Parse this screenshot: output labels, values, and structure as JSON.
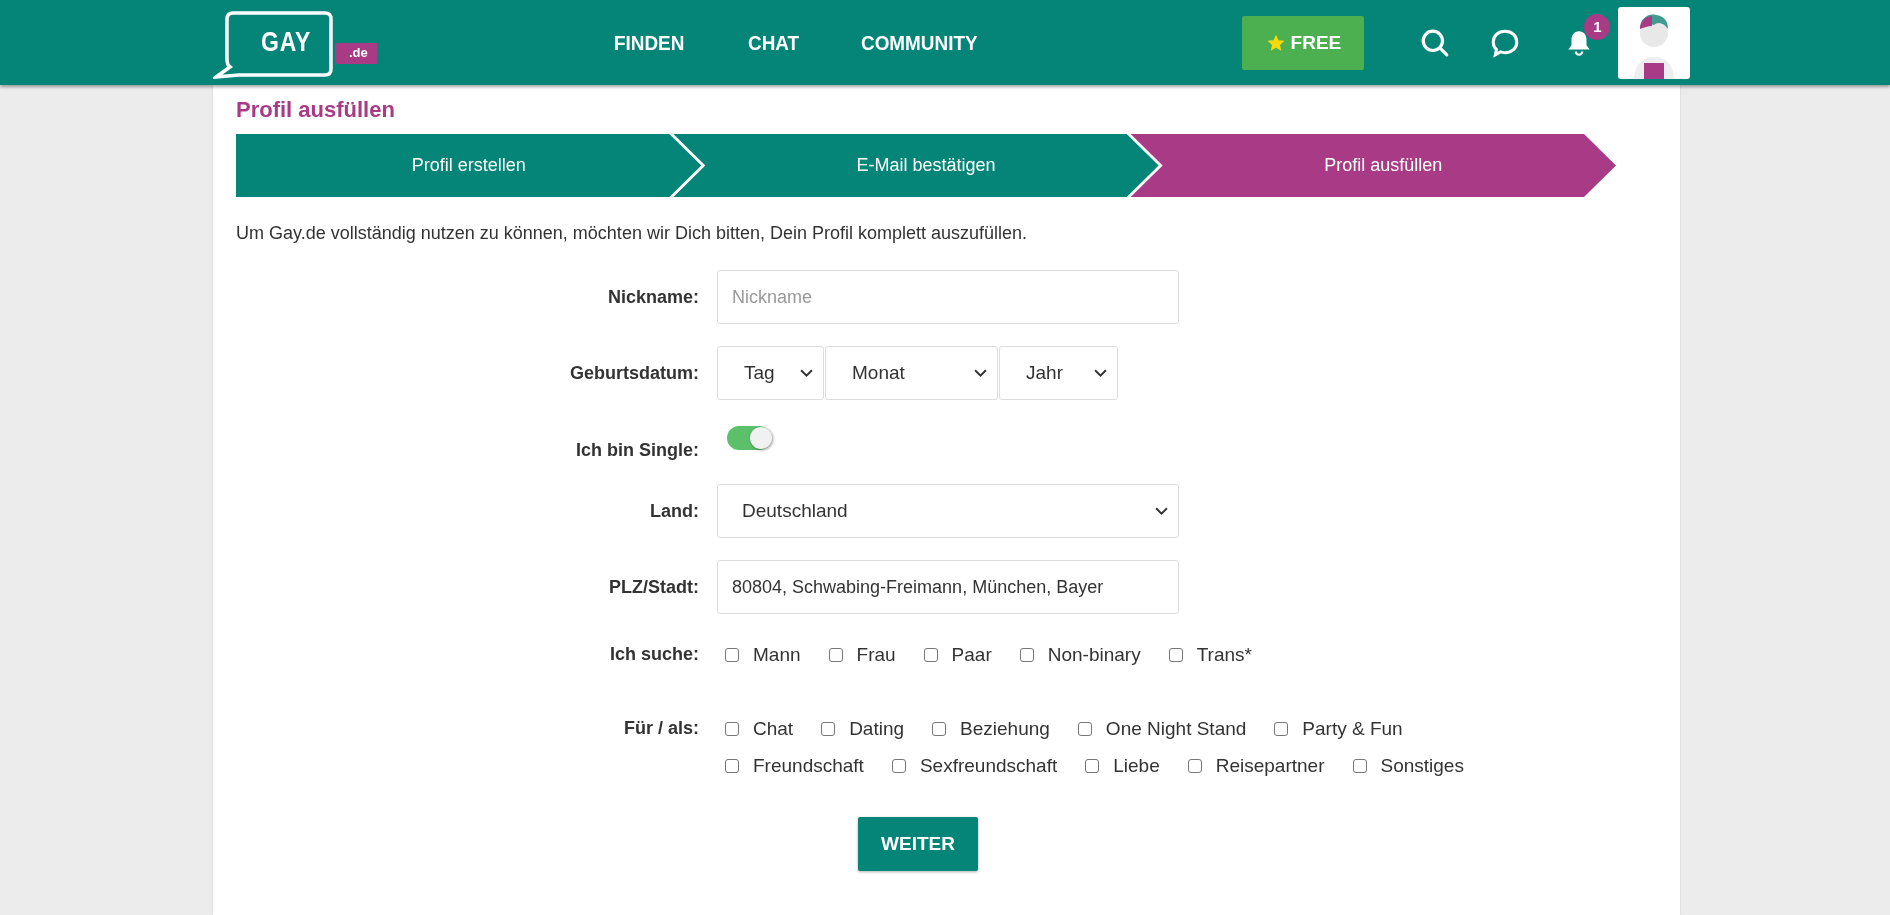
{
  "header": {
    "logo": {
      "main": "GAY",
      "suffix": ".de"
    },
    "nav": [
      {
        "label": "FINDEN"
      },
      {
        "label": "CHAT"
      },
      {
        "label": "COMMUNITY"
      }
    ],
    "free_button": "FREE",
    "notification_count": "1"
  },
  "page_title": "Profil ausfüllen",
  "steps": [
    {
      "label": "Profil erstellen",
      "selected": false
    },
    {
      "label": "E-Mail bestätigen",
      "selected": false
    },
    {
      "label": "Profil ausfüllen",
      "selected": true
    }
  ],
  "intro": "Um Gay.de vollständig nutzen zu können, möchten wir Dich bitten, Dein Profil komplett auszufüllen.",
  "form": {
    "nickname": {
      "label": "Nickname:",
      "placeholder": "Nickname"
    },
    "birthdate": {
      "label": "Geburtsdatum:",
      "selects": [
        {
          "value": "Tag"
        },
        {
          "value": "Monat"
        },
        {
          "value": "Jahr"
        }
      ]
    },
    "single": {
      "label": "Ich bin Single:",
      "on": true
    },
    "country": {
      "label": "Land:",
      "value": "Deutschland"
    },
    "city": {
      "label": "PLZ/Stadt:",
      "value": "80804, Schwabing-Freimann, München, Bayer"
    },
    "seeking": {
      "label": "Ich suche:",
      "options": [
        {
          "label": "Mann",
          "checked": false
        },
        {
          "label": "Frau",
          "checked": false
        },
        {
          "label": "Paar",
          "checked": false
        },
        {
          "label": "Non-binary",
          "checked": false
        },
        {
          "label": "Trans*",
          "checked": false
        }
      ]
    },
    "purpose": {
      "label": "Für / als:",
      "options": [
        {
          "label": "Chat",
          "checked": false
        },
        {
          "label": "Dating",
          "checked": false
        },
        {
          "label": "Beziehung",
          "checked": false
        },
        {
          "label": "One Night Stand",
          "checked": false
        },
        {
          "label": "Party & Fun",
          "checked": false
        },
        {
          "label": "Freundschaft",
          "checked": false
        },
        {
          "label": "Sexfreundschaft",
          "checked": false
        },
        {
          "label": "Liebe",
          "checked": false
        },
        {
          "label": "Reisepartner",
          "checked": false
        },
        {
          "label": "Sonstiges",
          "checked": false
        }
      ]
    },
    "submit": "WEITER"
  }
}
